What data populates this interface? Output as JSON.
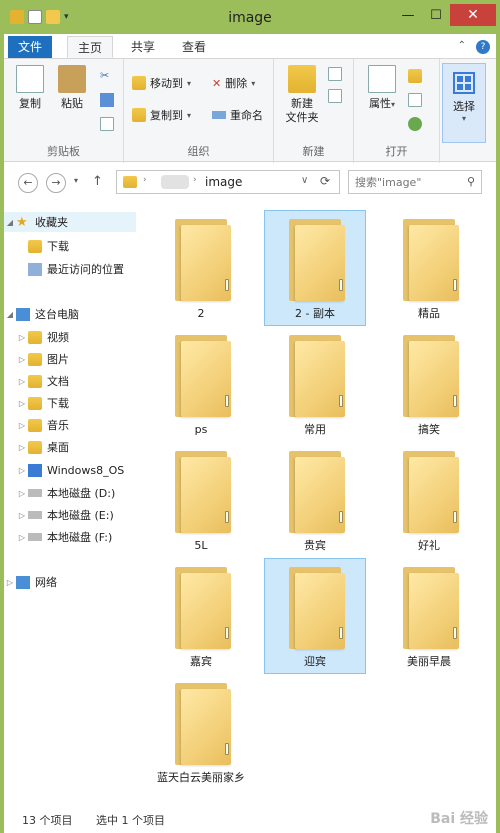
{
  "window": {
    "title": "image"
  },
  "ribbon_tabs": {
    "file": "文件",
    "home": "主页",
    "share": "共享",
    "view": "查看"
  },
  "ribbon": {
    "clipboard": {
      "label": "剪贴板",
      "copy": "复制",
      "paste": "粘贴"
    },
    "organize": {
      "label": "组织",
      "move_to": "移动到",
      "copy_to": "复制到",
      "delete": "删除",
      "rename": "重命名"
    },
    "new": {
      "label": "新建",
      "new_folder_line1": "新建",
      "new_folder_line2": "文件夹"
    },
    "open": {
      "label": "打开",
      "properties": "属性"
    },
    "select": {
      "label": "选择"
    }
  },
  "address": {
    "current": "image",
    "search_placeholder": "搜索\"image\""
  },
  "nav": {
    "favorites": "收藏夹",
    "favorites_items": [
      "下载",
      "最近访问的位置"
    ],
    "this_pc": "这台电脑",
    "this_pc_items": [
      "视频",
      "图片",
      "文档",
      "下载",
      "音乐",
      "桌面",
      "Windows8_OS",
      "本地磁盘 (D:)",
      "本地磁盘 (E:)",
      "本地磁盘 (F:)"
    ],
    "network": "网络"
  },
  "files": [
    {
      "name": "2",
      "selected": false
    },
    {
      "name": "2 - 副本",
      "selected": true
    },
    {
      "name": "精品",
      "selected": false
    },
    {
      "name": "ps",
      "selected": false
    },
    {
      "name": "常用",
      "selected": false
    },
    {
      "name": "搞笑",
      "selected": false
    },
    {
      "name": "5L",
      "selected": false
    },
    {
      "name": "贵宾",
      "selected": false
    },
    {
      "name": "好礼",
      "selected": false
    },
    {
      "name": "嘉宾",
      "selected": false
    },
    {
      "name": "迎宾",
      "selected": true
    },
    {
      "name": "美丽早晨",
      "selected": false
    },
    {
      "name": "蓝天白云美丽家乡",
      "selected": false
    }
  ],
  "status": {
    "item_count": "13 个项目",
    "selected_count": "选中 1 个项目"
  },
  "watermark": "Bai 经验",
  "colors": {
    "titlebar": "#9bbe5a",
    "file_tab": "#1f6fbf",
    "selection": "#cde8fb",
    "close": "#c8413a"
  }
}
